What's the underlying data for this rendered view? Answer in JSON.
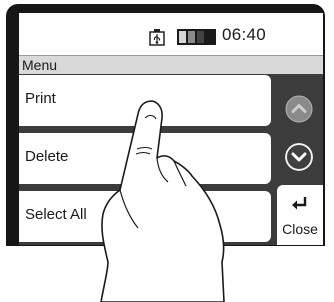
{
  "status_bar": {
    "time": "06:40",
    "icons": [
      "usb-icon",
      "battery-icon"
    ]
  },
  "menu": {
    "title": "Menu",
    "items": [
      {
        "label": "Print"
      },
      {
        "label": "Delete"
      },
      {
        "label": "Select All"
      }
    ]
  },
  "controls": {
    "scroll_up_icon": "chevron-up-icon",
    "scroll_down_icon": "chevron-down-icon",
    "close_icon": "return-arrow-icon",
    "close_label": "Close"
  },
  "colors": {
    "bezel": "#161616",
    "screen_background": "#3c3c3c",
    "scroll_up": "#8a8a8a",
    "scroll_down": "#404040"
  }
}
